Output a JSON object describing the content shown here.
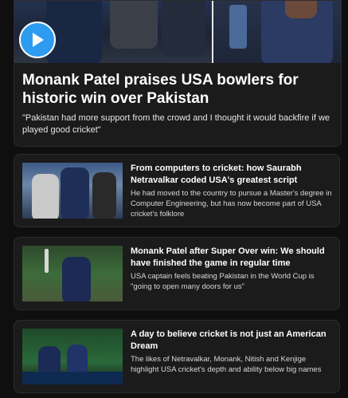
{
  "hero": {
    "title": "Monank Patel praises USA bowlers for historic win over Pakistan",
    "subtitle": "\"Pakistan had more support from the crowd and I thought it would backfire if we played good cricket\"",
    "play_icon": "play-icon",
    "accent_color": "#2d9bf0"
  },
  "articles": [
    {
      "title": "From computers to cricket: how Saurabh Netravalkar coded USA's greatest script",
      "description": "He had moved to the country to pursue a Master's degree in Computer Engineering, but has now become part of USA cricket's folklore"
    },
    {
      "title": "Monank Patel after Super Over win: We should have finished the game in regular time",
      "description": "USA captain feels beating Pakistan in the World Cup is \"going to open many doors for us\""
    },
    {
      "title": "A day to believe cricket is not just an American Dream",
      "description": "The likes of Netravalkar, Monank, Nitish and Kenjige highlight USA cricket's depth and ability below big names"
    }
  ]
}
